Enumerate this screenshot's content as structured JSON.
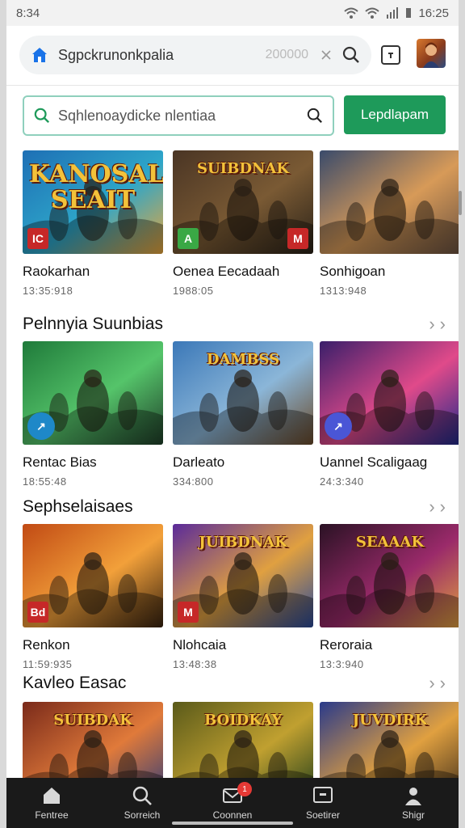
{
  "status": {
    "time": "8:34",
    "clock": "16:25"
  },
  "browser": {
    "url": "Sgpckrunonkpalia",
    "count": "200000",
    "search_placeholder": "Sqhlenoaydicke nlentiaa",
    "search_button": "Lepdlapam"
  },
  "sections": [
    {
      "title": "",
      "items": [
        {
          "title": "Raokarhan",
          "sub": "13:35:918",
          "art": "KANOSAL SEAIT",
          "badge": "IC",
          "badge_color": "#c62828",
          "bg": [
            "#1e6fb5",
            "#2ea6c9",
            "#e9a53a"
          ]
        },
        {
          "title": "Oenea Eecadaah",
          "sub": "1988:05",
          "art": "SUIBDNAK",
          "badge": "A",
          "badge_color": "#3aa845",
          "badge2": "M",
          "bg": [
            "#4a3524",
            "#7a5a34",
            "#2a2218"
          ]
        },
        {
          "title": "Sonhigoan",
          "sub": "1313:948",
          "art": "",
          "badge": "",
          "badge_color": "",
          "bg": [
            "#3a4b6b",
            "#d79a58",
            "#6b5240"
          ]
        }
      ]
    },
    {
      "title": "Pelnnyia Suunbias",
      "items": [
        {
          "title": "Rentac Bias",
          "sub": "18:55:48",
          "art": "",
          "badge": "↗",
          "badge_color": "#1e88c8",
          "bg": [
            "#1f7a3a",
            "#55c46a",
            "#20402a"
          ]
        },
        {
          "title": "Darleato",
          "sub": "334:800",
          "art": "DAMBSS",
          "badge": "",
          "badge_color": "",
          "bg": [
            "#3b78b8",
            "#8bb6d8",
            "#6a4a2a"
          ]
        },
        {
          "title": "Uannel Scaligaag",
          "sub": "24:3:340",
          "art": "",
          "badge": "↗",
          "badge_color": "#4a56d6",
          "bg": [
            "#3a1f6a",
            "#e04a8a",
            "#1e2a8a"
          ]
        }
      ]
    },
    {
      "title": "Sephselaisaes",
      "items": [
        {
          "title": "Renkon",
          "sub": "11:59:935",
          "art": "",
          "badge": "Bd",
          "badge_color": "#c62828",
          "bg": [
            "#c14a14",
            "#f2a03a",
            "#3a2410"
          ]
        },
        {
          "title": "Nlohcaia",
          "sub": "13:48:38",
          "art": "JUIBDNAK",
          "badge": "M",
          "badge_color": "#c62828",
          "bg": [
            "#5a2a9a",
            "#e0a040",
            "#2a4a9a"
          ]
        },
        {
          "title": "Reroraia",
          "sub": "13:3:940",
          "art": "SEAAAK",
          "badge": "",
          "badge_color": "",
          "bg": [
            "#2a1224",
            "#9a2a6a",
            "#e0a040"
          ]
        }
      ]
    },
    {
      "title": "Kavleo Easac",
      "items": [
        {
          "title": "",
          "sub": "",
          "art": "SUIBDAK",
          "badge": "",
          "badge_color": "",
          "bg": [
            "#7a2a1a",
            "#e07a3a",
            "#2a3a7a"
          ]
        },
        {
          "title": "",
          "sub": "",
          "art": "BOIDKAY",
          "badge": "",
          "badge_color": "",
          "bg": [
            "#5a5a1a",
            "#c0a030",
            "#1a3a1a"
          ]
        },
        {
          "title": "",
          "sub": "",
          "art": "JUVDIRK",
          "badge": "",
          "badge_color": "",
          "bg": [
            "#2a3a8a",
            "#e0a040",
            "#3a2a1a"
          ]
        }
      ]
    }
  ],
  "nav": [
    {
      "label": "Fentree",
      "icon": "home-icon"
    },
    {
      "label": "Sorreich",
      "icon": "search-icon"
    },
    {
      "label": "Coonnen",
      "icon": "mail-icon",
      "dot": "1"
    },
    {
      "label": "Soetirer",
      "icon": "tv-icon"
    },
    {
      "label": "Shigr",
      "icon": "profile-icon"
    }
  ],
  "colors": {
    "accent": "#1e9a5a",
    "nav_bg": "#1a1a1a"
  }
}
